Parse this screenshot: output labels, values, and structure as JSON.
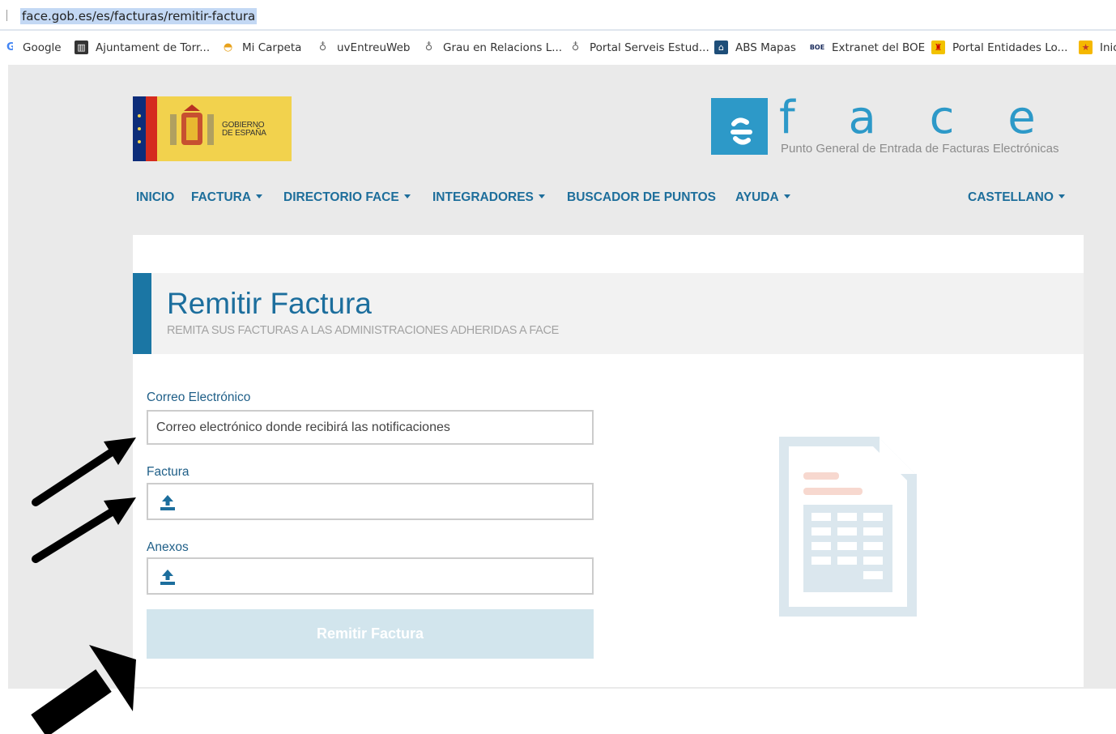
{
  "browser": {
    "url": "face.gob.es/es/facturas/remitir-factura",
    "bookmarks": [
      {
        "label": "Google",
        "icon": "google-icon"
      },
      {
        "label": "Ajuntament de Torr...",
        "icon": "building-icon"
      },
      {
        "label": "Mi Carpeta",
        "icon": "folder-icon"
      },
      {
        "label": "uvEntreuWeb",
        "icon": "uv-icon"
      },
      {
        "label": "Grau en Relacions L...",
        "icon": "uv-icon"
      },
      {
        "label": "Portal Serveis Estud...",
        "icon": "uv-icon"
      },
      {
        "label": "ABS Mapas",
        "icon": "map-icon"
      },
      {
        "label": "Extranet del BOE",
        "icon": "boe-icon",
        "icon_text": "BOE"
      },
      {
        "label": "Portal Entidades Lo...",
        "icon": "shield-icon"
      },
      {
        "label": "Inic",
        "icon": "star-icon"
      }
    ]
  },
  "header": {
    "gob_logo_text": "GOBIERNO\nDE ESPAÑA",
    "face_letters": "f a c e",
    "face_tagline": "Punto General de Entrada de Facturas Electrónicas"
  },
  "nav": {
    "items": [
      {
        "label": "INICIO",
        "dropdown": false
      },
      {
        "label": "FACTURA",
        "dropdown": true
      },
      {
        "label": "DIRECTORIO FACE",
        "dropdown": true
      },
      {
        "label": "INTEGRADORES",
        "dropdown": true
      },
      {
        "label": "BUSCADOR DE PUNTOS",
        "dropdown": false
      },
      {
        "label": "AYUDA",
        "dropdown": true
      }
    ],
    "language": "CASTELLANO"
  },
  "main": {
    "title": "Remitir Factura",
    "subtitle": "REMITA SUS FACTURAS A LAS ADMINISTRACIONES ADHERIDAS A FACE",
    "email_label": "Correo Electrónico",
    "email_placeholder": "Correo electrónico donde recibirá las notificaciones",
    "factura_label": "Factura",
    "anexos_label": "Anexos",
    "submit_label": "Remitir Factura"
  },
  "colors": {
    "primary": "#1c6e9d",
    "accent_bar": "#1b76a4",
    "logo_blue": "#2d99c8",
    "submit_disabled_bg": "#d2e5ed",
    "page_bg": "#eaeaea"
  }
}
